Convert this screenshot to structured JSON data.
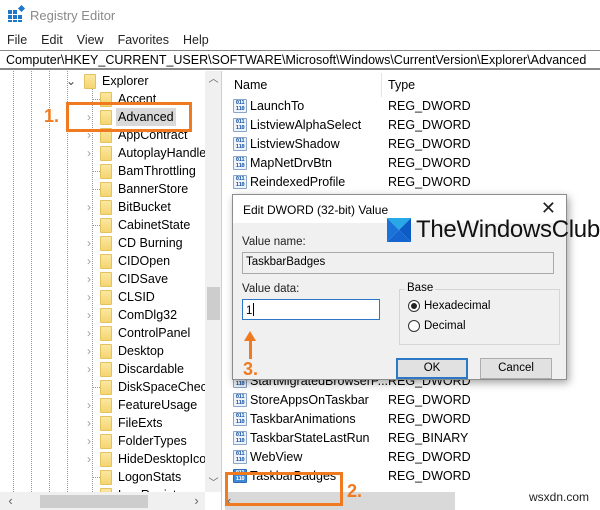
{
  "window": {
    "title": "Registry Editor"
  },
  "menu": [
    "File",
    "Edit",
    "View",
    "Favorites",
    "Help"
  ],
  "address": "Computer\\HKEY_CURRENT_USER\\SOFTWARE\\Microsoft\\Windows\\CurrentVersion\\Explorer\\Advanced",
  "tree": {
    "parent": "Explorer",
    "items": [
      {
        "label": "Accent",
        "expandable": false
      },
      {
        "label": "Advanced",
        "expandable": true,
        "selected": true
      },
      {
        "label": "AppContract",
        "expandable": true
      },
      {
        "label": "AutoplayHandle",
        "expandable": true
      },
      {
        "label": "BamThrottling",
        "expandable": false
      },
      {
        "label": "BannerStore",
        "expandable": false
      },
      {
        "label": "BitBucket",
        "expandable": true
      },
      {
        "label": "CabinetState",
        "expandable": false
      },
      {
        "label": "CD Burning",
        "expandable": true
      },
      {
        "label": "CIDOpen",
        "expandable": true
      },
      {
        "label": "CIDSave",
        "expandable": true
      },
      {
        "label": "CLSID",
        "expandable": true
      },
      {
        "label": "ComDlg32",
        "expandable": true
      },
      {
        "label": "ControlPanel",
        "expandable": true
      },
      {
        "label": "Desktop",
        "expandable": true
      },
      {
        "label": "Discardable",
        "expandable": true
      },
      {
        "label": "DiskSpaceCheck",
        "expandable": false
      },
      {
        "label": "FeatureUsage",
        "expandable": true
      },
      {
        "label": "FileExts",
        "expandable": true
      },
      {
        "label": "FolderTypes",
        "expandable": true
      },
      {
        "label": "HideDesktopIco",
        "expandable": true
      },
      {
        "label": "LogonStats",
        "expandable": false
      },
      {
        "label": "LowRegistry",
        "expandable": false
      }
    ]
  },
  "values": {
    "columns": {
      "name": "Name",
      "type": "Type"
    },
    "rows_top": [
      {
        "name": "LaunchTo",
        "type": "REG_DWORD"
      },
      {
        "name": "ListviewAlphaSelect",
        "type": "REG_DWORD"
      },
      {
        "name": "ListviewShadow",
        "type": "REG_DWORD"
      },
      {
        "name": "MapNetDrvBtn",
        "type": "REG_DWORD"
      },
      {
        "name": "ReindexedProfile",
        "type": "REG_DWORD"
      }
    ],
    "rows_bottom": [
      {
        "name": "StartMigratedBrowserP...",
        "type": "REG_DWORD"
      },
      {
        "name": "StoreAppsOnTaskbar",
        "type": "REG_DWORD"
      },
      {
        "name": "TaskbarAnimations",
        "type": "REG_DWORD"
      },
      {
        "name": "TaskbarStateLastRun",
        "type": "REG_BINARY"
      },
      {
        "name": "WebView",
        "type": "REG_DWORD"
      },
      {
        "name": "TaskbarBadges",
        "type": "REG_DWORD",
        "selected": true
      }
    ]
  },
  "dialog": {
    "title": "Edit DWORD (32-bit) Value",
    "close": "✕",
    "value_name_label": "Value name:",
    "value_name": "TaskbarBadges",
    "value_data_label": "Value data:",
    "value_data": "1",
    "base_label": "Base",
    "base_options": [
      {
        "label": "Hexadecimal",
        "checked": true
      },
      {
        "label": "Decimal",
        "checked": false
      }
    ],
    "ok": "OK",
    "cancel": "Cancel"
  },
  "annotations": {
    "step1": "1.",
    "step2": "2.",
    "step3": "3."
  },
  "watermarks": {
    "brand": "TheWindowsClub",
    "site": "wsxdn.com"
  },
  "colors": {
    "annotation": "#f07a20",
    "accent": "#2c77c6"
  }
}
